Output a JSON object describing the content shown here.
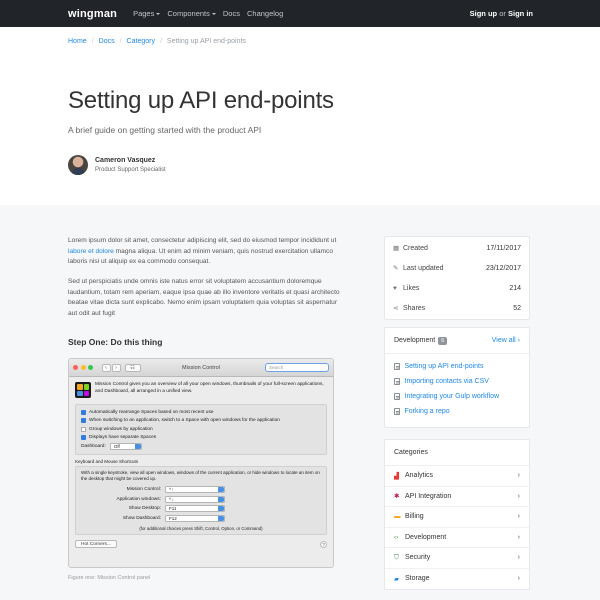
{
  "navbar": {
    "brand": "wingman",
    "links": [
      {
        "label": "Pages",
        "dropdown": true
      },
      {
        "label": "Components",
        "dropdown": true
      },
      {
        "label": "Docs",
        "dropdown": false
      },
      {
        "label": "Changelog",
        "dropdown": false
      }
    ],
    "signup": "Sign up",
    "or": "or",
    "signin": "Sign in"
  },
  "breadcrumb": [
    "Home",
    "Docs",
    "Category",
    "Setting up API end-points"
  ],
  "header": {
    "title": "Setting up API end-points",
    "subtitle": "A brief guide on getting started with the product API",
    "author_name": "Cameron Vasquez",
    "author_role": "Product Support Specialist"
  },
  "content": {
    "para1": "Lorem ipsum dolor sit amet, consectetur adipiscing elit, sed do eiusmod tempor incididunt ut labore et dolore magna aliqua. Ut enim ad minim veniam, quis nostrud exercitation ullamco laboris nisi ut aliquip ex ea commodo consequat.",
    "para1_link": "labore et dolore",
    "para2": "Sed ut perspiciatis unde omnis iste natus error sit voluptatem accusantium doloremque laudantium, totam rem aperiam, eaque ipsa quae ab illo inventore veritatis et quasi architecto beatae vitae dicta sunt explicabo. Nemo enim ipsam voluptatem quia voluptas sit aspernatur aut odit aut fugit",
    "step_title": "Step One: Do this thing",
    "figure_caption": "Figure one: Mission Control panel"
  },
  "mac_window": {
    "title": "Mission Control",
    "search_placeholder": "Search",
    "grid_btn": "☷",
    "description": "Mission Control gives you an overview of all your open windows, thumbnails of your full-screen applications, and Dashboard, all arranged in a unified view.",
    "options": [
      {
        "label": "Automatically rearrange Spaces based on most recent use",
        "checked": true
      },
      {
        "label": "When switching to an application, switch to a Space with open windows for the application",
        "checked": true
      },
      {
        "label": "Group windows by application",
        "checked": false
      },
      {
        "label": "Displays have separate Spaces",
        "checked": true
      }
    ],
    "dashboard_label": "Dashboard:",
    "dashboard_value": "Off",
    "shortcuts_label": "Keyboard and Mouse Shortcuts",
    "shortcuts_desc": "With a single keystroke, view all open windows, windows of the current application, or hide windows to locate an item on the desktop that might be covered up.",
    "shortcuts": [
      {
        "label": "Mission Control:",
        "value": "^↑"
      },
      {
        "label": "Application windows:",
        "value": "^↓"
      },
      {
        "label": "Show Desktop:",
        "value": "F11"
      },
      {
        "label": "Show Dashboard:",
        "value": "F12"
      }
    ],
    "shortcuts_note": "(for additional choices press Shift, Control, Option, or Command)",
    "hot_corners": "Hot Corners...",
    "help": "?"
  },
  "stats": [
    {
      "icon": "calendar-icon",
      "glyph": "▦",
      "label": "Created",
      "value": "17/11/2017"
    },
    {
      "icon": "pencil-icon",
      "glyph": "✎",
      "label": "Last updated",
      "value": "23/12/2017"
    },
    {
      "icon": "heart-icon",
      "glyph": "♥",
      "label": "Likes",
      "value": "214"
    },
    {
      "icon": "share-icon",
      "glyph": "⋖",
      "label": "Shares",
      "value": "52"
    }
  ],
  "development": {
    "title": "Development",
    "count": "6",
    "view_all": "View all ›",
    "links": [
      "Setting up API end-points",
      "Importing contacts via CSV",
      "Integrating your Gulp workflow",
      "Forking a repo"
    ]
  },
  "categories": {
    "title": "Categories",
    "items": [
      {
        "label": "Analytics",
        "icon": "chart-icon",
        "glyph": "▟",
        "color": "#e53935"
      },
      {
        "label": "API Integration",
        "icon": "puzzle-icon",
        "glyph": "✱",
        "color": "#c2185b"
      },
      {
        "label": "Billing",
        "icon": "card-icon",
        "glyph": "▬",
        "color": "#f9a825"
      },
      {
        "label": "Development",
        "icon": "code-icon",
        "glyph": "‹›",
        "color": "#43a047"
      },
      {
        "label": "Security",
        "icon": "shield-icon",
        "glyph": "⛉",
        "color": "#2e7d32"
      },
      {
        "label": "Storage",
        "icon": "folder-icon",
        "glyph": "▰",
        "color": "#1e88e5"
      }
    ]
  }
}
